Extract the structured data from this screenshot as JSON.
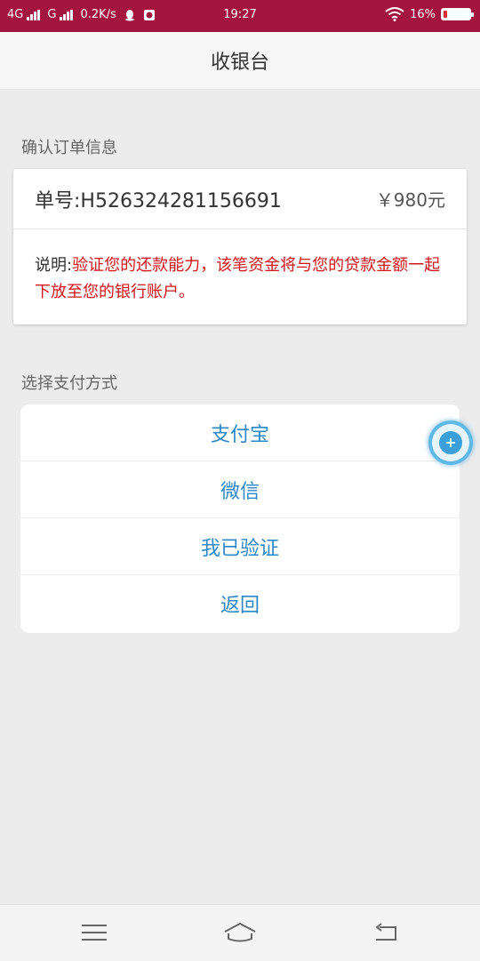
{
  "status_bar": {
    "network1": "4G",
    "network2": "G",
    "speed": "0.2K/s",
    "time": "19:27",
    "battery": "16%",
    "battery_level": 0.16
  },
  "header": {
    "title": "收银台"
  },
  "order_section": {
    "label": "确认订单信息",
    "order_number": "单号:H526324281156691",
    "amount": "￥980元",
    "note_label": "说明:",
    "note_text": "验证您的还款能力，该笔资金将与您的贷款金额一起下放至您的银行账户。"
  },
  "payment_section": {
    "label": "选择支付方式",
    "options": [
      "支付宝",
      "微信",
      "我已验证",
      "返回"
    ]
  },
  "colors": {
    "status_bar": "#a3153f",
    "accent": "#2b87c8",
    "note_red": "#d3141b"
  },
  "icons": {
    "nav": [
      "menu-icon",
      "home-icon",
      "back-icon"
    ],
    "floating": "assistive-touch-icon"
  }
}
